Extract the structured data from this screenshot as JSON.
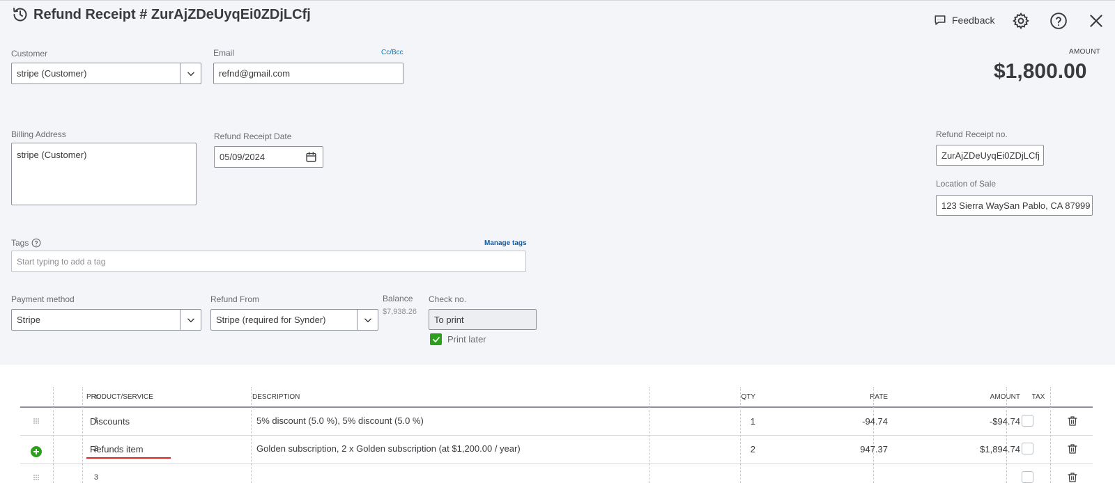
{
  "header": {
    "title": "Refund Receipt # ZurAjZDeUyqEi0ZDjLCfj",
    "title_icon": "history-icon",
    "feedback_label": "Feedback",
    "icons": [
      "gear-icon",
      "help-icon",
      "close-icon"
    ]
  },
  "customer": {
    "label": "Customer",
    "value": "stripe (Customer)"
  },
  "email": {
    "label": "Email",
    "value": "refnd@gmail.com",
    "ccbcc": "Cc/Bcc"
  },
  "amount": {
    "label": "AMOUNT",
    "value": "$1,800.00"
  },
  "billing": {
    "label": "Billing Address",
    "value": "stripe (Customer)"
  },
  "date": {
    "label": "Refund Receipt Date",
    "value": "05/09/2024"
  },
  "receipt_no": {
    "label": "Refund Receipt no.",
    "value": "ZurAjZDeUyqEi0ZDjLCfj"
  },
  "location": {
    "label": "Location of Sale",
    "value": "123 Sierra WaySan Pablo, CA  87999"
  },
  "tags": {
    "label": "Tags",
    "manage": "Manage tags",
    "placeholder": "Start typing to add a tag"
  },
  "payment": {
    "label": "Payment method",
    "value": "Stripe"
  },
  "refund_from": {
    "label": "Refund From",
    "value": "Stripe (required for Synder)"
  },
  "balance": {
    "label": "Balance",
    "value": "$7,938.26"
  },
  "check": {
    "label": "Check no.",
    "value": "To print",
    "print_later": "Print later",
    "print_later_checked": true
  },
  "table": {
    "headers": {
      "num": "#",
      "product": "PRODUCT/SERVICE",
      "description": "DESCRIPTION",
      "qty": "QTY",
      "rate": "RATE",
      "amount": "AMOUNT",
      "tax": "TAX"
    },
    "rows": [
      {
        "num": "1",
        "product": "Discounts",
        "description": "5% discount (5.0 %), 5% discount (5.0 %)",
        "qty": "1",
        "rate": "-94.74",
        "amount": "-$94.74"
      },
      {
        "num": "2",
        "product": "Refunds item",
        "description": "Golden subscription, 2 x Golden subscription (at $1,200.00 / year)",
        "qty": "2",
        "rate": "947.37",
        "amount": "$1,894.74"
      },
      {
        "num": "3",
        "product": "",
        "description": "",
        "qty": "",
        "rate": "",
        "amount": ""
      }
    ]
  },
  "colors": {
    "accent_green": "#2ca01c",
    "link_blue": "#0077c5",
    "annotation_red": "#e3251f"
  }
}
